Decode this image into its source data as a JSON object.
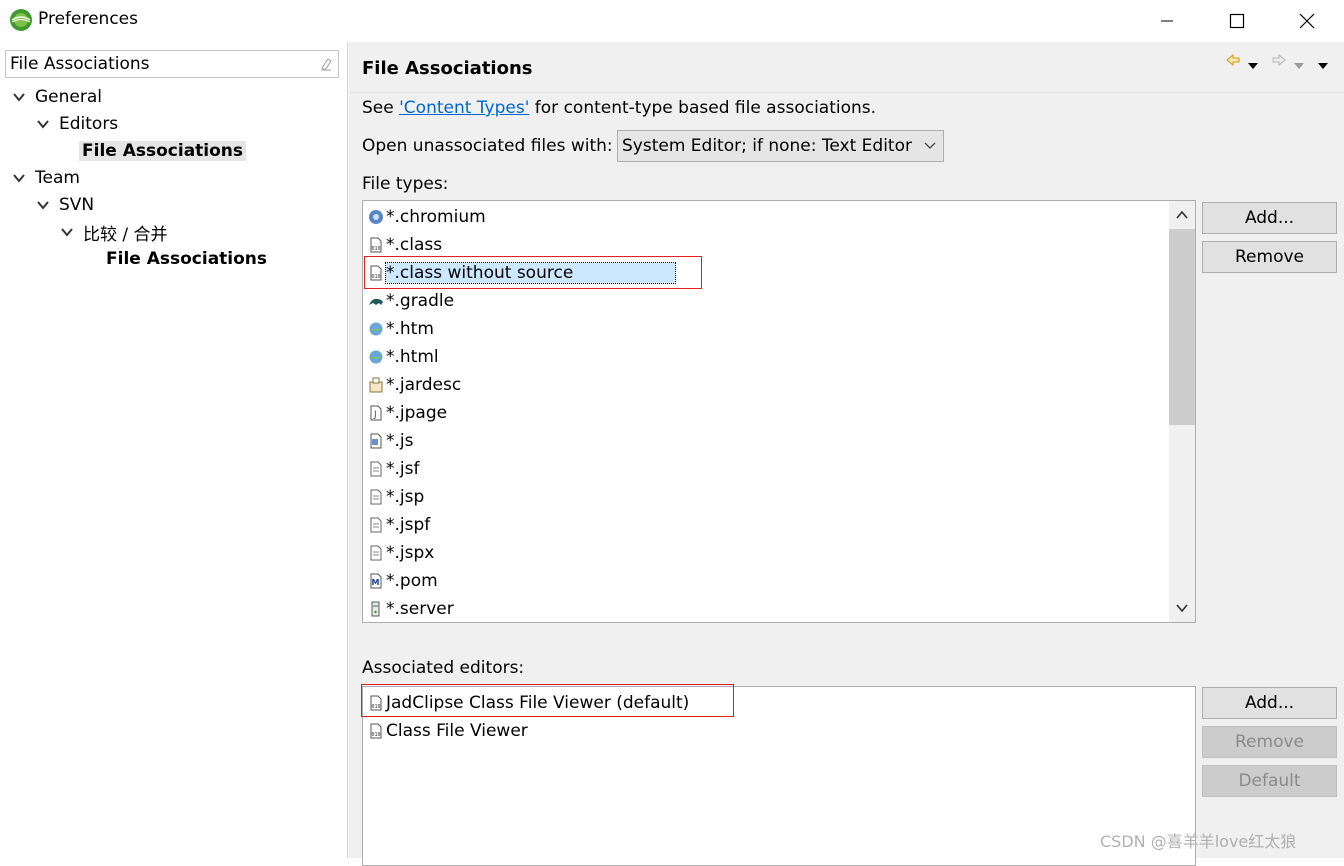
{
  "window": {
    "title": "Preferences"
  },
  "filter": {
    "value": "File Associations"
  },
  "tree": [
    {
      "label": "General",
      "expanded": true
    },
    {
      "label": "Editors",
      "expanded": true
    },
    {
      "label": "File Associations",
      "selected": true
    },
    {
      "label": "Team",
      "expanded": true
    },
    {
      "label": "SVN",
      "expanded": true
    },
    {
      "label": "比较 / 合并",
      "expanded": true
    },
    {
      "label": "File Associations"
    }
  ],
  "page": {
    "title": "File Associations",
    "see_prefix": "See ",
    "see_link": "'Content Types'",
    "see_suffix": " for content-type based file associations.",
    "unassoc_label": "Open unassociated files with:",
    "unassoc_value": "System Editor; if none: Text Editor",
    "file_types_label": "File types:",
    "file_types": [
      {
        "name": "*.chromium",
        "icon": "chromium-icon"
      },
      {
        "name": "*.class",
        "icon": "class-file-icon"
      },
      {
        "name": "*.class without source",
        "icon": "class-file-icon",
        "selected": true
      },
      {
        "name": "*.gradle",
        "icon": "gradle-icon"
      },
      {
        "name": "*.htm",
        "icon": "globe-icon"
      },
      {
        "name": "*.html",
        "icon": "globe-icon"
      },
      {
        "name": "*.jardesc",
        "icon": "jar-icon"
      },
      {
        "name": "*.jpage",
        "icon": "java-page-icon"
      },
      {
        "name": "*.js",
        "icon": "js-file-icon"
      },
      {
        "name": "*.jsf",
        "icon": "text-file-icon"
      },
      {
        "name": "*.jsp",
        "icon": "text-file-icon"
      },
      {
        "name": "*.jspf",
        "icon": "text-file-icon"
      },
      {
        "name": "*.jspx",
        "icon": "text-file-icon"
      },
      {
        "name": "*.pom",
        "icon": "maven-icon"
      },
      {
        "name": "*.server",
        "icon": "server-icon"
      }
    ],
    "file_types_add": "Add...",
    "file_types_remove": "Remove",
    "assoc_label": "Associated editors:",
    "editors": [
      {
        "name": "JadClipse Class File Viewer (default)",
        "icon": "class-file-icon"
      },
      {
        "name": "Class File Viewer",
        "icon": "class-file-icon"
      }
    ],
    "editors_add": "Add...",
    "editors_remove": "Remove",
    "editors_default": "Default"
  },
  "watermark": "CSDN @喜羊羊love红太狼",
  "colors": {
    "selection": "#cce8ff",
    "link": "#0066cc",
    "highlight_box": "#e02020"
  }
}
